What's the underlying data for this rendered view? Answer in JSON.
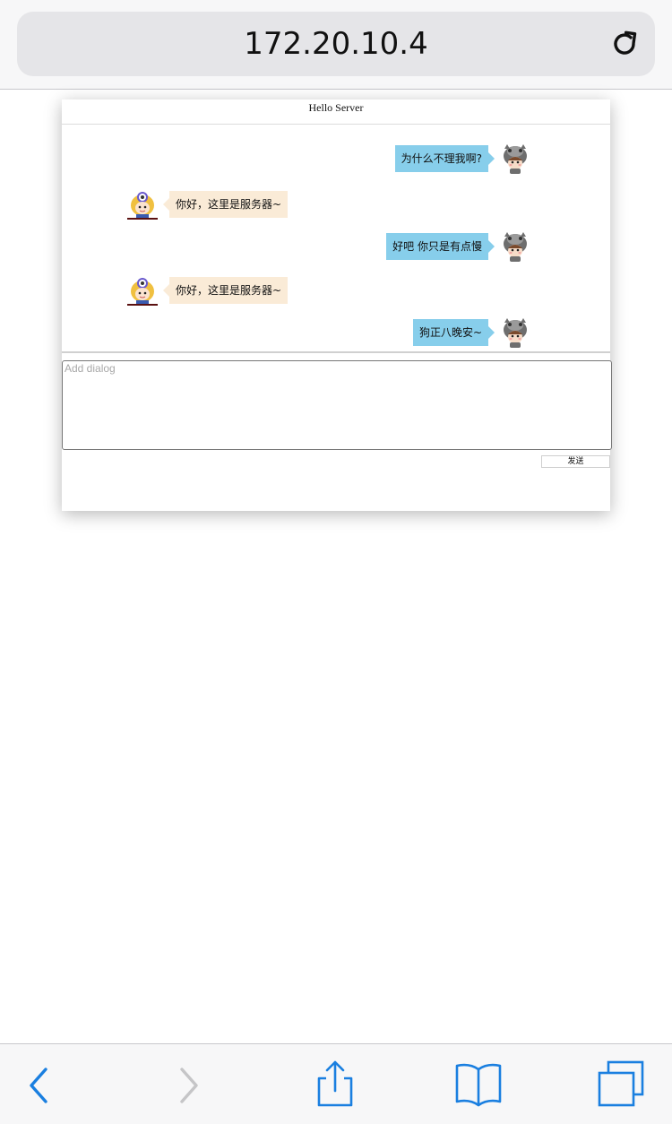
{
  "browser": {
    "url": "172.20.10.4",
    "icons": {
      "reload": "reload-icon",
      "back": "back-chevron-icon",
      "forward": "forward-chevron-icon",
      "share": "share-icon",
      "bookmarks": "bookmarks-icon",
      "tabs": "tabs-icon"
    },
    "accent_color": "#1a7fe0"
  },
  "chat": {
    "title": "Hello Server",
    "messages": [
      {
        "from": "client",
        "text": "为什么不理我啊?",
        "avatar": "client-avatar"
      },
      {
        "from": "server",
        "text": "你好，这里是服务器~",
        "avatar": "server-avatar"
      },
      {
        "from": "client",
        "text": "好吧 你只是有点慢",
        "avatar": "client-avatar"
      },
      {
        "from": "server",
        "text": "你好，这里是服务器~",
        "avatar": "server-avatar"
      },
      {
        "from": "client",
        "text": "狗正八晚安~",
        "avatar": "client-avatar"
      }
    ],
    "input": {
      "placeholder": "Add dialog",
      "value": ""
    },
    "send_label": "发送",
    "colors": {
      "client_bubble": "#87ceeb",
      "server_bubble": "#faebd7"
    }
  }
}
